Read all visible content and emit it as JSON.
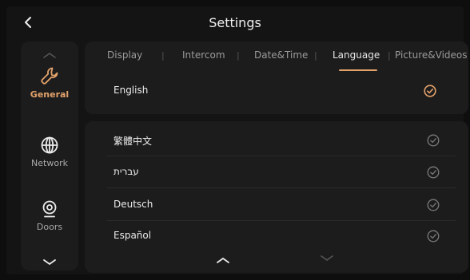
{
  "header": {
    "title": "Settings",
    "back_icon": "chevron-left-icon"
  },
  "sidebar": {
    "items": [
      {
        "label": "General",
        "icon": "wrench-icon",
        "active": true
      },
      {
        "label": "Network",
        "icon": "globe-icon",
        "active": false
      },
      {
        "label": "Doors",
        "icon": "camera-icon",
        "active": false
      }
    ],
    "up_icon": "chevron-up-icon",
    "down_icon": "chevron-down-icon"
  },
  "tabs": [
    {
      "label": "Display"
    },
    {
      "label": "Intercom"
    },
    {
      "label": "Date&Time"
    },
    {
      "label": "Language",
      "active": true
    },
    {
      "label": "Picture&Videos"
    }
  ],
  "selected_language": {
    "label": "English",
    "checked": true
  },
  "languages": [
    {
      "label": "繁體中文",
      "checked": false
    },
    {
      "label": "עברית",
      "checked": false
    },
    {
      "label": "Deutsch",
      "checked": false
    },
    {
      "label": "Español",
      "checked": false
    }
  ],
  "pager": {
    "up_icon": "chevron-up-icon",
    "down_icon": "chevron-down-icon"
  },
  "colors": {
    "accent": "#e3a26a",
    "background": "#141414",
    "panel": "#1c1c1d",
    "muted": "#9a9a9a"
  }
}
